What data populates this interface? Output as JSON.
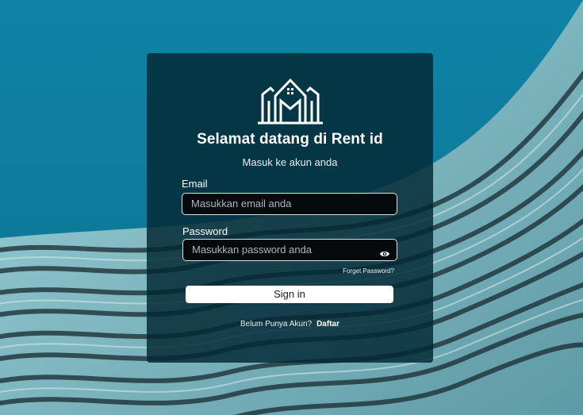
{
  "login": {
    "title": "Selamat datang di Rent id",
    "subtitle": "Masuk ke akun anda",
    "email_label": "Email",
    "email_placeholder": "Masukkan email anda",
    "password_label": "Password",
    "password_placeholder": "Masukkan password anda",
    "password_toggle_icon": "eye-icon",
    "forgot_password": "Forget Password?",
    "signin_label": "Sign in",
    "register_prompt": "Belum Punya Akun?",
    "register_link": "Daftar"
  },
  "colors": {
    "background_sky": "#0d7fa0",
    "card": "#022834",
    "button": "#ffffff"
  }
}
